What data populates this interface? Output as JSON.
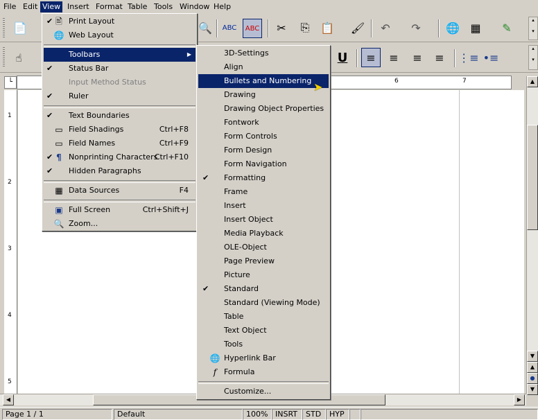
{
  "menubar": {
    "items": [
      "File",
      "Edit",
      "View",
      "Insert",
      "Format",
      "Table",
      "Tools",
      "Window",
      "Help"
    ]
  },
  "view_menu": {
    "items": [
      {
        "label": "Print Layout",
        "shortcut": "",
        "checked": true,
        "icon": "print-layout-icon"
      },
      {
        "label": "Web Layout",
        "shortcut": "",
        "checked": false,
        "icon": "web-layout-icon"
      },
      {
        "label": "Toolbars",
        "shortcut": "",
        "checked": false,
        "icon": "",
        "submenu": true
      },
      {
        "label": "Status Bar",
        "shortcut": "",
        "checked": true,
        "icon": ""
      },
      {
        "label": "Input Method Status",
        "shortcut": "",
        "checked": false,
        "icon": "",
        "disabled": true
      },
      {
        "label": "Ruler",
        "shortcut": "",
        "checked": true,
        "icon": ""
      },
      {
        "label": "Text Boundaries",
        "shortcut": "",
        "checked": true,
        "icon": ""
      },
      {
        "label": "Field Shadings",
        "shortcut": "Ctrl+F8",
        "checked": false,
        "icon": "field-shadings-icon"
      },
      {
        "label": "Field Names",
        "shortcut": "Ctrl+F9",
        "checked": false,
        "icon": "field-names-icon"
      },
      {
        "label": "Nonprinting Characters",
        "shortcut": "Ctrl+F10",
        "checked": true,
        "icon": "pilcrow-icon"
      },
      {
        "label": "Hidden Paragraphs",
        "shortcut": "",
        "checked": true,
        "icon": ""
      },
      {
        "label": "Data Sources",
        "shortcut": "F4",
        "checked": false,
        "icon": "data-sources-icon"
      },
      {
        "label": "Full Screen",
        "shortcut": "Ctrl+Shift+J",
        "checked": false,
        "icon": "full-screen-icon"
      },
      {
        "label": "Zoom...",
        "shortcut": "",
        "checked": false,
        "icon": "zoom-icon"
      }
    ]
  },
  "toolbars_submenu": {
    "items": [
      {
        "label": "3D-Settings",
        "checked": false
      },
      {
        "label": "Align",
        "checked": false
      },
      {
        "label": "Bullets and Numbering",
        "checked": false,
        "highlighted": true
      },
      {
        "label": "Drawing",
        "checked": false
      },
      {
        "label": "Drawing Object Properties",
        "checked": false
      },
      {
        "label": "Fontwork",
        "checked": false
      },
      {
        "label": "Form Controls",
        "checked": false
      },
      {
        "label": "Form Design",
        "checked": false
      },
      {
        "label": "Form Navigation",
        "checked": false
      },
      {
        "label": "Formatting",
        "checked": true
      },
      {
        "label": "Frame",
        "checked": false
      },
      {
        "label": "Insert",
        "checked": false
      },
      {
        "label": "Insert Object",
        "checked": false
      },
      {
        "label": "Media Playback",
        "checked": false
      },
      {
        "label": "OLE-Object",
        "checked": false
      },
      {
        "label": "Page Preview",
        "checked": false
      },
      {
        "label": "Picture",
        "checked": false
      },
      {
        "label": "Standard",
        "checked": true
      },
      {
        "label": "Standard (Viewing Mode)",
        "checked": false
      },
      {
        "label": "Table",
        "checked": false
      },
      {
        "label": "Text Object",
        "checked": false
      },
      {
        "label": "Tools",
        "checked": false
      },
      {
        "label": "Hyperlink Bar",
        "checked": false,
        "icon": "hyperlink-bar-icon"
      },
      {
        "label": "Formula",
        "checked": false,
        "icon": "formula-icon"
      },
      {
        "label": "Customize...",
        "checked": false
      }
    ]
  },
  "ruler": {
    "h_numbers": [
      "6",
      "7"
    ],
    "v_numbers": [
      "1",
      "2",
      "3",
      "4",
      "5"
    ]
  },
  "statusbar": {
    "page": "Page 1 / 1",
    "style": "Default",
    "zoom": "100%",
    "insert_mode": "INSRT",
    "selection_mode": "STD",
    "hyphenation": "HYP"
  },
  "colors": {
    "highlight": "#0a246a",
    "face": "#d4d0c8"
  }
}
